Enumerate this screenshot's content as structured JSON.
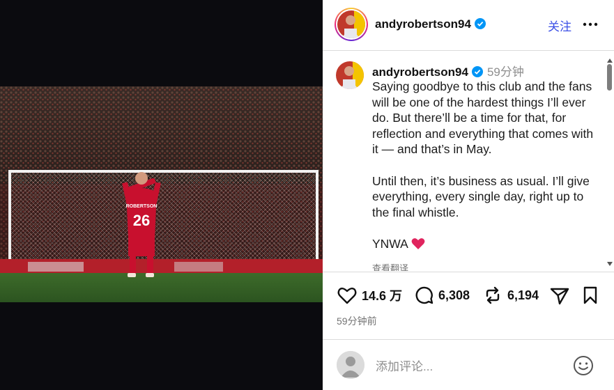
{
  "header": {
    "username": "andyrobertson94",
    "follow_label": "关注"
  },
  "caption": {
    "username": "andyrobertson94",
    "time": "59分钟",
    "paragraph1": "Saying goodbye to this club and the fans will be one of the hardest things I’ll ever do. But there’ll be a time for that, for reflection and everything that comes with it — and that’s in May.",
    "paragraph2": "Until then, it’s business as usual. I’ll give everything, every single day, right up to the final whistle.",
    "sign_off": "YNWA",
    "translate_label": "查看翻译"
  },
  "photo": {
    "jersey_name": "ROBERTSON",
    "jersey_number": "26"
  },
  "actions": {
    "likes": "14.6 万",
    "comments": "6,308",
    "reposts": "6,194"
  },
  "posted_time": "59分钟前",
  "comment_bar": {
    "placeholder": "添加评论..."
  },
  "icons": {
    "verified": "verified-badge-icon",
    "more": "more-options-icon",
    "like": "heart-icon",
    "comment": "comment-bubble-icon",
    "repost": "repost-icon",
    "share": "share-send-icon",
    "save": "bookmark-icon",
    "emoji": "emoji-smile-icon"
  },
  "colors": {
    "follow": "#3c50e6",
    "verified": "#0095f6",
    "heart_emoji": "#e0245e",
    "jersey": "#c8102e"
  }
}
